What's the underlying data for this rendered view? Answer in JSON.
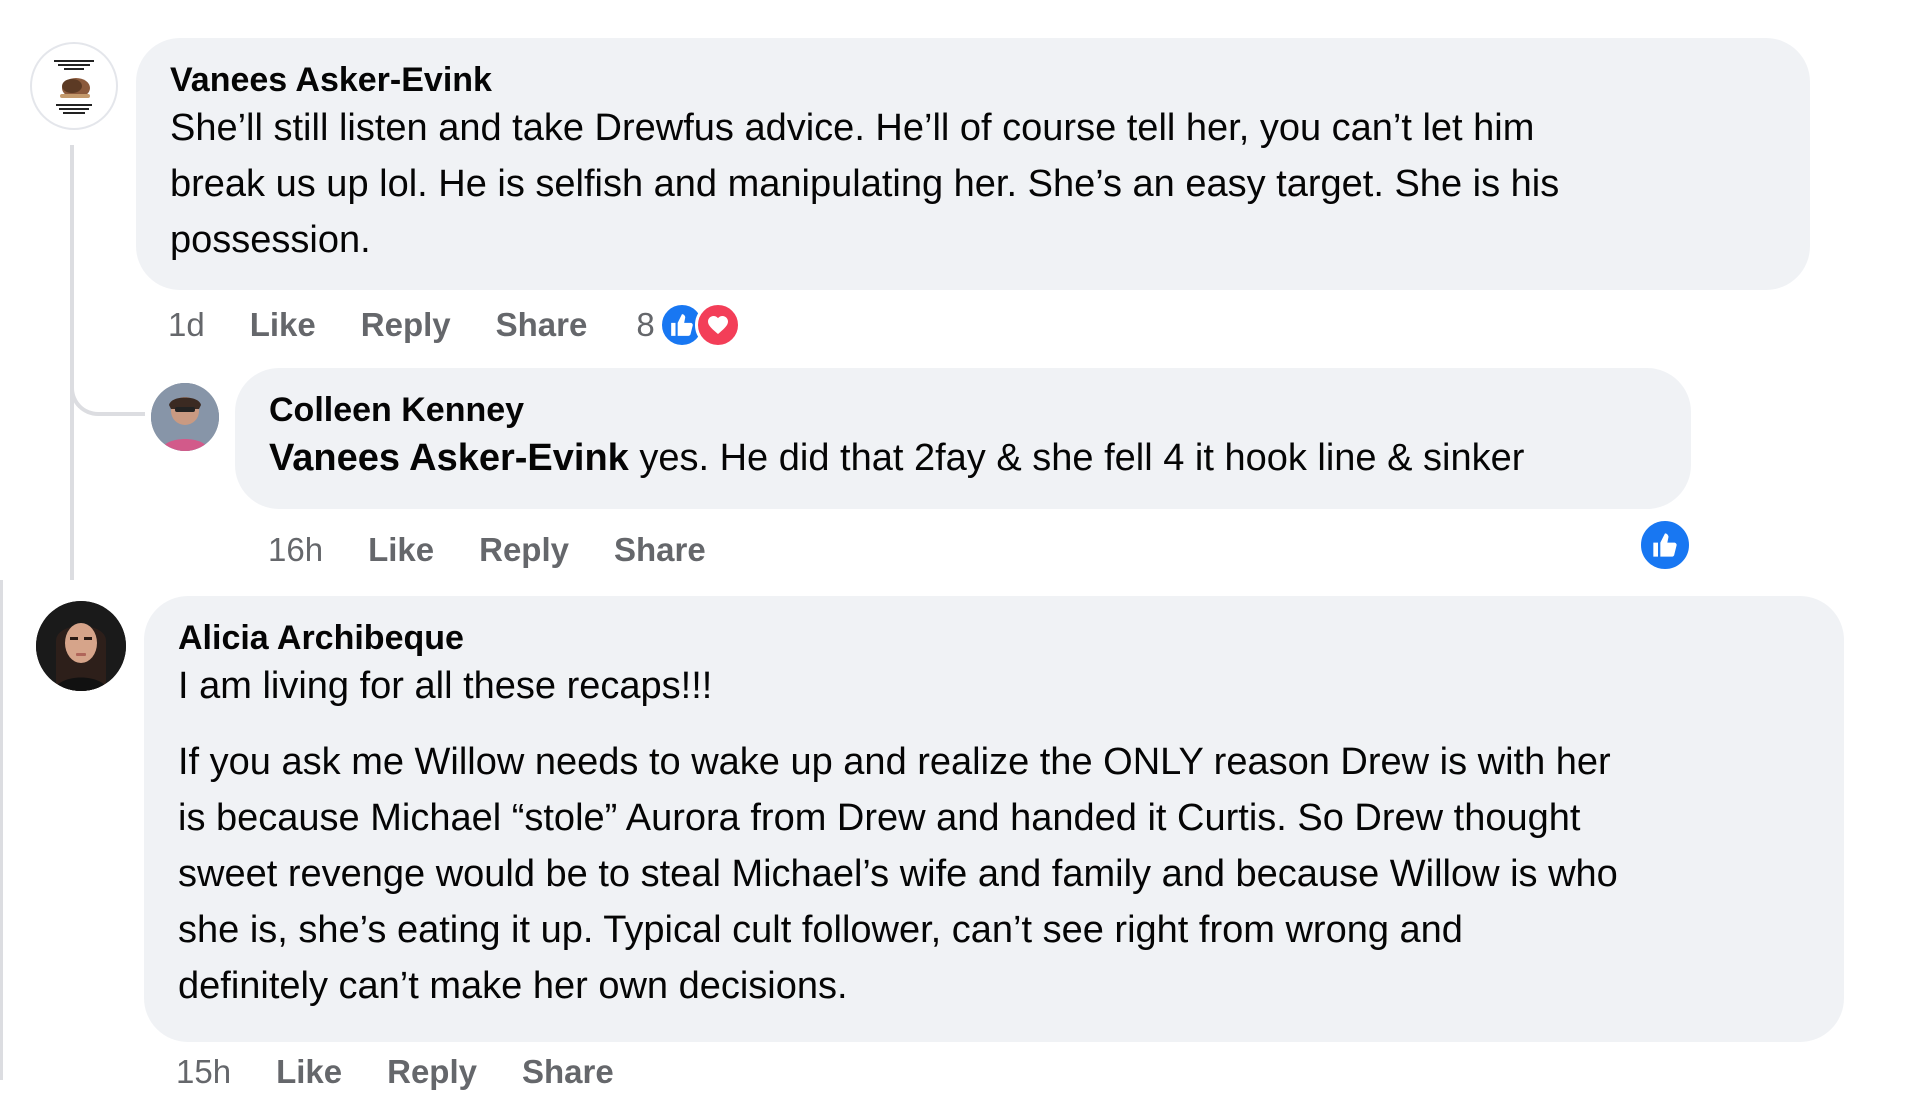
{
  "comments": [
    {
      "author": "Vanees Asker-Evink",
      "avatar_caption_top": "I DON'T HAVE A PROBLEM WITH CAFFEINE",
      "avatar_caption_bottom": "I HAVE A PROBLEM WITHOUT CAFFEINE",
      "text_lines": [
        "She’ll still listen and take Drewfus advice. He’ll of course tell her, you can’t let him",
        "break us up lol. He is selfish and manipulating her. She’s an easy target. She is his",
        "possession."
      ],
      "time": "1d",
      "like_label": "Like",
      "reply_label": "Reply",
      "share_label": "Share",
      "reaction_count": "8",
      "reactions": [
        "like-icon",
        "love-icon"
      ]
    },
    {
      "author": "Colleen Kenney",
      "mention": "Vanees Asker-Evink",
      "text": " yes. He did that 2fay & she fell 4 it hook line & sinker",
      "time": "16h",
      "like_label": "Like",
      "reply_label": "Reply",
      "share_label": "Share",
      "reactions": [
        "like-icon"
      ]
    },
    {
      "author": "Alicia Archibeque",
      "text_first": "I am living for all these recaps!!!",
      "text_lines": [
        "If you ask me Willow needs to wake up and realize the ONLY reason Drew is with her",
        "is because Michael “stole” Aurora from Drew and handed it Curtis. So Drew thought",
        "sweet revenge would be to steal Michael’s wife and family and because Willow is who",
        "she is, she’s eating it up. Typical cult follower, can’t see right from wrong and",
        "definitely can’t make her own decisions."
      ],
      "time": "15h",
      "like_label": "Like",
      "reply_label": "Reply",
      "share_label": "Share"
    }
  ],
  "colors": {
    "bubble": "#f0f2f5",
    "meta_text": "#65676b",
    "like_blue": "#1877f2",
    "love_red": "#f33e58",
    "thread_line": "#dcdde1"
  }
}
